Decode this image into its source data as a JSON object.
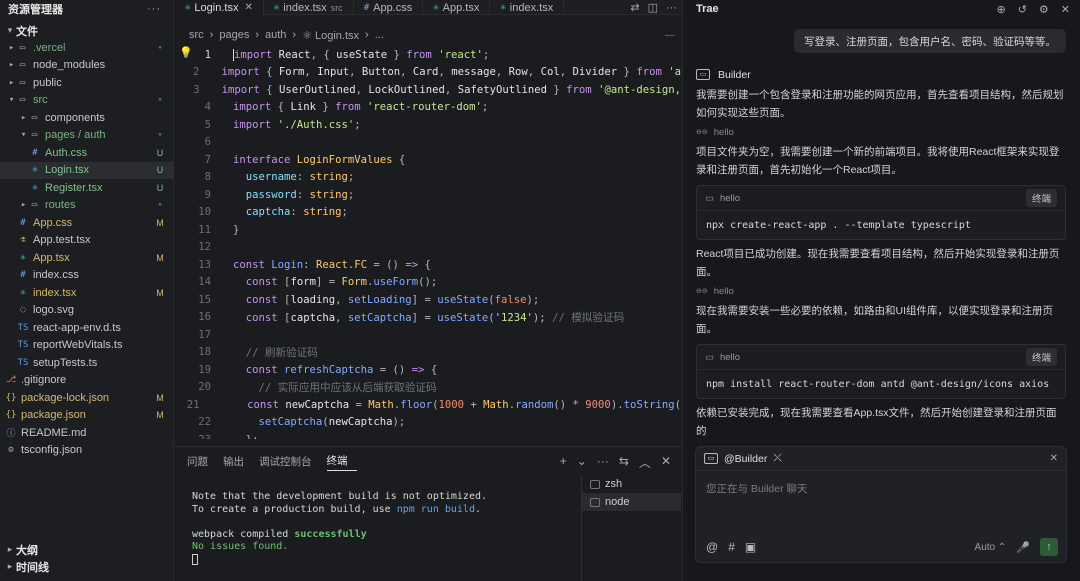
{
  "explorer": {
    "title": "资源管理器",
    "more": "···",
    "section_files": "文件",
    "tree": [
      {
        "name": ".vercel",
        "icon": "▸ ▭",
        "status": "●",
        "depth": 0,
        "kind": "folder",
        "color": "dim"
      },
      {
        "name": "node_modules",
        "icon": "▸ ▭",
        "status": "",
        "depth": 0,
        "kind": "folder",
        "color": "norm"
      },
      {
        "name": "public",
        "icon": "▸ ▭",
        "status": "",
        "depth": 0,
        "kind": "folder",
        "color": "norm"
      },
      {
        "name": "src",
        "icon": "▾ ▭",
        "status": "●",
        "depth": 0,
        "kind": "folder",
        "color": "dim"
      },
      {
        "name": "components",
        "icon": "▸ ▭",
        "status": "",
        "depth": 1,
        "kind": "folder",
        "color": "norm"
      },
      {
        "name": "pages / auth",
        "icon": "▾ ▭",
        "status": "●",
        "depth": 1,
        "kind": "folder",
        "color": "dim"
      },
      {
        "name": "Auth.css",
        "icon": "#",
        "status": "U",
        "depth": 2,
        "kind": "file",
        "color": "new"
      },
      {
        "name": "Login.tsx",
        "icon": "⚛",
        "status": "U",
        "depth": 2,
        "kind": "file",
        "color": "new",
        "active": true
      },
      {
        "name": "Register.tsx",
        "icon": "⚛",
        "status": "U",
        "depth": 2,
        "kind": "file",
        "color": "new"
      },
      {
        "name": "routes",
        "icon": "▸ ▭",
        "status": "●",
        "depth": 1,
        "kind": "folder",
        "color": "dim"
      },
      {
        "name": "App.css",
        "icon": "#",
        "status": "M",
        "depth": 1,
        "kind": "file",
        "color": "mod"
      },
      {
        "name": "App.test.tsx",
        "icon": "⚗",
        "status": "",
        "depth": 1,
        "kind": "file",
        "color": "norm"
      },
      {
        "name": "App.tsx",
        "icon": "⚛",
        "status": "M",
        "depth": 1,
        "kind": "file",
        "color": "mod"
      },
      {
        "name": "index.css",
        "icon": "#",
        "status": "",
        "depth": 1,
        "kind": "file",
        "color": "norm"
      },
      {
        "name": "index.tsx",
        "icon": "⚛",
        "status": "M",
        "depth": 1,
        "kind": "file",
        "color": "mod"
      },
      {
        "name": "logo.svg",
        "icon": "◌",
        "status": "",
        "depth": 1,
        "kind": "file",
        "color": "norm"
      },
      {
        "name": "react-app-env.d.ts",
        "icon": "TS",
        "status": "",
        "depth": 1,
        "kind": "file",
        "color": "norm"
      },
      {
        "name": "reportWebVitals.ts",
        "icon": "TS",
        "status": "",
        "depth": 1,
        "kind": "file",
        "color": "norm"
      },
      {
        "name": "setupTests.ts",
        "icon": "TS",
        "status": "",
        "depth": 1,
        "kind": "file",
        "color": "norm"
      },
      {
        "name": ".gitignore",
        "icon": "⎇",
        "status": "",
        "depth": 0,
        "kind": "file",
        "color": "norm"
      },
      {
        "name": "package-lock.json",
        "icon": "{}",
        "status": "M",
        "depth": 0,
        "kind": "file",
        "color": "mod"
      },
      {
        "name": "package.json",
        "icon": "{}",
        "status": "M",
        "depth": 0,
        "kind": "file",
        "color": "mod"
      },
      {
        "name": "README.md",
        "icon": "ⓘ",
        "status": "",
        "depth": 0,
        "kind": "file",
        "color": "norm"
      },
      {
        "name": "tsconfig.json",
        "icon": "⚙",
        "status": "",
        "depth": 0,
        "kind": "file",
        "color": "norm"
      }
    ],
    "section_outline": "大纲",
    "section_timeline": "时间线"
  },
  "editor": {
    "tabs": [
      {
        "icon": "⚛",
        "label": "Login.tsx",
        "sub": "",
        "close": "✕",
        "active": true
      },
      {
        "icon": "⚛",
        "label": "index.tsx",
        "sub": "src",
        "close": "",
        "active": false
      },
      {
        "icon": "#",
        "label": "App.css",
        "sub": "",
        "close": "",
        "active": false
      },
      {
        "icon": "⚛",
        "label": "App.tsx",
        "sub": "",
        "close": "",
        "active": false
      },
      {
        "icon": "⚛",
        "label": "index.tsx",
        "sub": "",
        "close": "",
        "active": false
      }
    ],
    "breadcrumb": [
      "src",
      "›",
      "pages",
      "›",
      "auth",
      "›",
      "⚛ Login.tsx",
      "›",
      "..."
    ],
    "code_lines": [
      {
        "n": "1",
        "html": "<span class='k'>import</span> <span class='v'>React</span><span class='p'>, {</span> <span class='v'>useState</span> <span class='p'>}</span> <span class='k'>from</span> <span class='s'>'react'</span><span class='p'>;</span>"
      },
      {
        "n": "2",
        "html": "<span class='k'>import</span> <span class='p'>{</span> <span class='v'>Form</span><span class='p'>,</span> <span class='v'>Input</span><span class='p'>,</span> <span class='v'>Button</span><span class='p'>,</span> <span class='v'>Card</span><span class='p'>,</span> <span class='v'>message</span><span class='p'>,</span> <span class='v'>Row</span><span class='p'>,</span> <span class='v'>Col</span><span class='p'>,</span> <span class='v'>Divider</span> <span class='p'>}</span> <span class='k'>from</span> <span class='s'>'a</span>"
      },
      {
        "n": "3",
        "html": "<span class='k'>import</span> <span class='p'>{</span> <span class='v'>UserOutlined</span><span class='p'>,</span> <span class='v'>LockOutlined</span><span class='p'>,</span> <span class='v'>SafetyOutlined</span> <span class='p'>}</span> <span class='k'>from</span> <span class='s'>'@ant-design,</span>"
      },
      {
        "n": "4",
        "html": "<span class='k'>import</span> <span class='p'>{</span> <span class='v'>Link</span> <span class='p'>}</span> <span class='k'>from</span> <span class='s'>'react-router-dom'</span><span class='p'>;</span>"
      },
      {
        "n": "5",
        "html": "<span class='k'>import</span> <span class='s'>'./Auth.css'</span><span class='p'>;</span>"
      },
      {
        "n": "6",
        "html": ""
      },
      {
        "n": "7",
        "html": "<span class='k'>interface</span> <span class='t'>LoginFormValues</span> <span class='p'>{</span>"
      },
      {
        "n": "8",
        "html": "  <span class='pr'>username</span><span class='p'>:</span> <span class='t'>string</span><span class='p'>;</span>"
      },
      {
        "n": "9",
        "html": "  <span class='pr'>password</span><span class='p'>:</span> <span class='t'>string</span><span class='p'>;</span>"
      },
      {
        "n": "10",
        "html": "  <span class='pr'>captcha</span><span class='p'>:</span> <span class='t'>string</span><span class='p'>;</span>"
      },
      {
        "n": "11",
        "html": "<span class='p'>}</span>"
      },
      {
        "n": "12",
        "html": ""
      },
      {
        "n": "13",
        "html": "<span class='k'>const</span> <span class='f'>Login</span><span class='p'>:</span> <span class='t'>React</span><span class='p'>.</span><span class='t'>FC</span> <span class='p'>=</span> <span class='p'>()</span> <span class='k'>=></span> <span class='p'>{</span>"
      },
      {
        "n": "14",
        "html": "  <span class='k'>const</span> <span class='p'>[</span><span class='v'>form</span><span class='p'>]</span> <span class='p'>=</span> <span class='t'>Form</span><span class='p'>.</span><span class='f'>useForm</span><span class='p'>();</span>"
      },
      {
        "n": "15",
        "html": "  <span class='k'>const</span> <span class='p'>[</span><span class='v'>loading</span><span class='p'>,</span> <span class='f'>setLoading</span><span class='p'>]</span> <span class='p'>=</span> <span class='f'>useState</span><span class='p'>(</span><span class='n'>false</span><span class='p'>);</span>"
      },
      {
        "n": "16",
        "html": "  <span class='k'>const</span> <span class='p'>[</span><span class='v'>captcha</span><span class='p'>,</span> <span class='f'>setCaptcha</span><span class='p'>]</span> <span class='p'>=</span> <span class='f'>useState</span><span class='p'>(</span><span class='s'>'1234'</span><span class='p'>);</span> <span class='c'>// 模拟验证码</span>"
      },
      {
        "n": "17",
        "html": ""
      },
      {
        "n": "18",
        "html": "  <span class='c'>// 刷新验证码</span>"
      },
      {
        "n": "19",
        "html": "  <span class='k'>const</span> <span class='f'>refreshCaptcha</span> <span class='p'>=</span> <span class='p'>()</span> <span class='k'>=></span> <span class='p'>{</span>"
      },
      {
        "n": "20",
        "html": "    <span class='c'>// 实际应用中应该从后端获取验证码</span>"
      },
      {
        "n": "21",
        "html": "    <span class='k'>const</span> <span class='v'>newCaptcha</span> <span class='p'>=</span> <span class='t'>Math</span><span class='p'>.</span><span class='f'>floor</span><span class='p'>(</span><span class='n'>1000</span> <span class='p'>+</span> <span class='t'>Math</span><span class='p'>.</span><span class='f'>random</span><span class='p'>()</span> <span class='p'>*</span> <span class='n'>9000</span><span class='p'>).</span><span class='f'>toString</span><span class='p'>(</span>"
      },
      {
        "n": "22",
        "html": "    <span class='f'>setCaptcha</span><span class='p'>(</span><span class='v'>newCaptcha</span><span class='p'>);</span>"
      },
      {
        "n": "23",
        "html": "  <span class='p'>};</span>"
      }
    ]
  },
  "terminal": {
    "tabs": [
      {
        "label": "问题",
        "active": false
      },
      {
        "label": "输出",
        "active": false
      },
      {
        "label": "调试控制台",
        "active": false
      },
      {
        "label": "终端",
        "active": true
      }
    ],
    "actions": [
      "+",
      "⌄",
      "···",
      "⇆",
      "︿",
      "✕"
    ],
    "output_html": "Note that the development build is not optimized.\nTo create a production build, use <span class='b'>npm run build</span>.\n\nwebpack compiled <span class='gb'>successfully</span>\n<span class='g'>No issues found.</span>\n",
    "instances": [
      {
        "label": "zsh",
        "active": false
      },
      {
        "label": "node",
        "active": true
      }
    ]
  },
  "chat": {
    "title": "Trae",
    "header_icons": [
      "⊕",
      "↺",
      "⚙",
      "✕"
    ],
    "user_message": "写登录、注册页面，包含用户名、密码、验证码等等。",
    "agent_name": "Builder",
    "blocks": [
      {
        "type": "text",
        "text": "我需要创建一个包含登录和注册功能的网页应用，首先查看项目结构，然后规划如何实现这些页面。"
      },
      {
        "type": "think",
        "icon": "⊝⊝",
        "text": "hello"
      },
      {
        "type": "text",
        "text": "项目文件夹为空，我需要创建一个新的前端项目。我将使用React框架来实现登录和注册页面，首先初始化一个React项目。"
      },
      {
        "type": "cmd",
        "head": "hello",
        "btn": "终端",
        "cmd": "npx create-react-app . --template typescript"
      },
      {
        "type": "text",
        "text": "React项目已成功创建。现在我需要查看项目结构，然后开始实现登录和注册页面。"
      },
      {
        "type": "think",
        "icon": "⊝⊝",
        "text": "hello"
      },
      {
        "type": "text",
        "text": "现在我需要安装一些必要的依赖，如路由和UI组件库，以便实现登录和注册页面。"
      },
      {
        "type": "cmd",
        "head": "hello",
        "btn": "终端",
        "cmd": "npm install react-router-dom antd @ant-design/icons axios"
      },
      {
        "type": "text",
        "text": "依赖已安装完成，现在我需要查看App.tsx文件，然后开始创建登录和注册页面的"
      }
    ],
    "input": {
      "agent": "@Builder",
      "agent_icon": "⤫",
      "close": "✕",
      "placeholder": "您正在与 Builder 聊天",
      "tools": [
        "@",
        "#",
        "▣"
      ],
      "model": "Auto",
      "model_chevron": "⌃",
      "mic": "🎙",
      "send": "↑"
    }
  }
}
